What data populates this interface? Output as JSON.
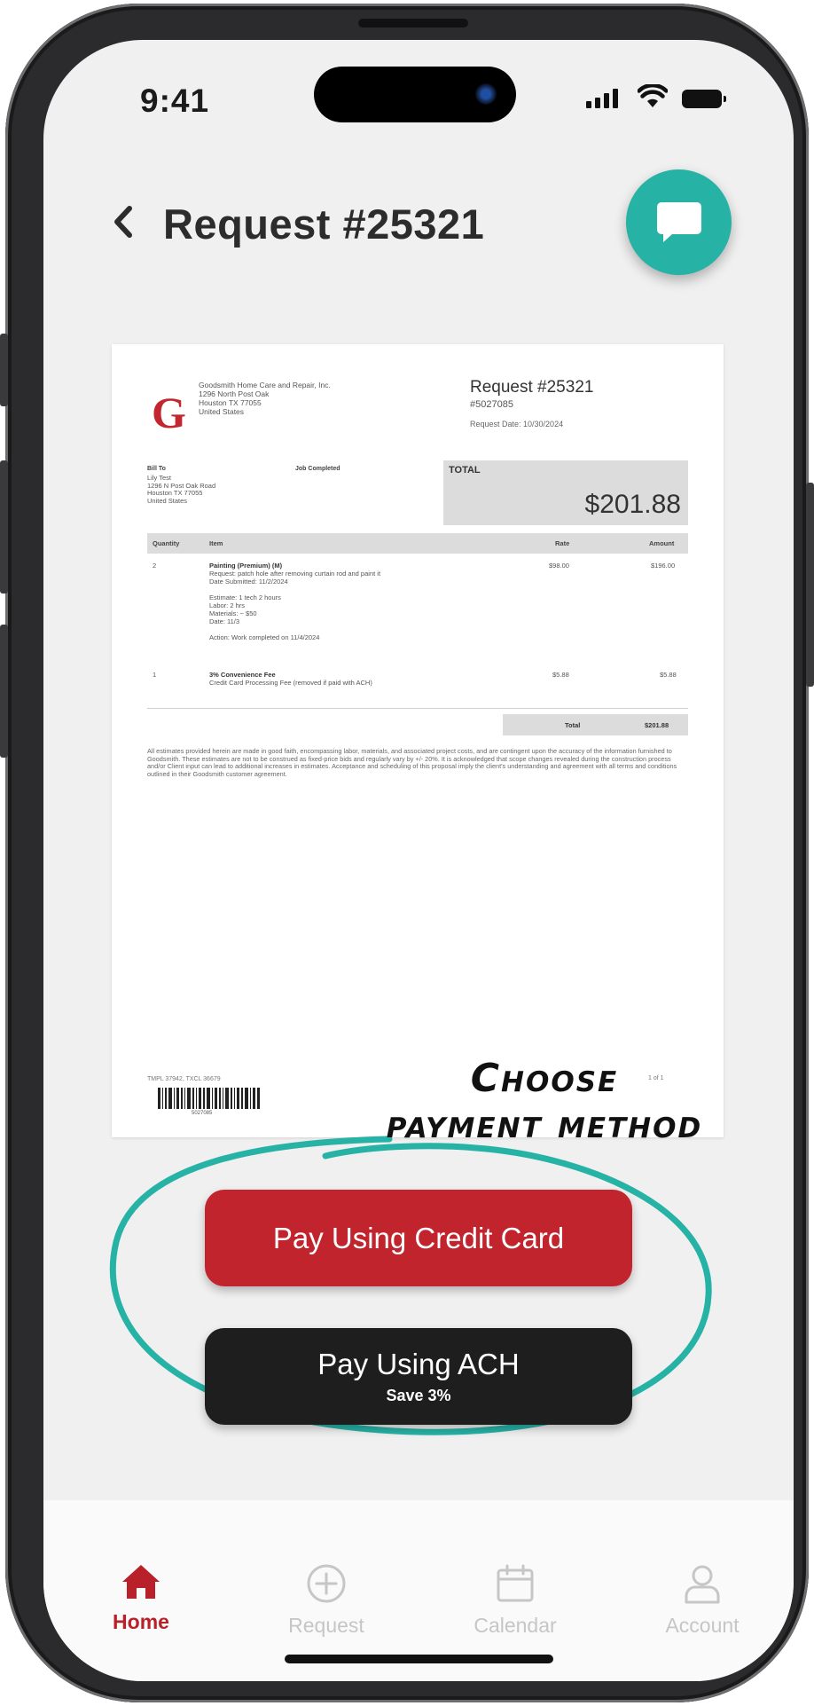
{
  "status_bar": {
    "time": "9:41"
  },
  "header": {
    "title": "Request #25321"
  },
  "document": {
    "company_lines": [
      "Goodsmith Home Care and Repair, Inc.",
      "1296 North Post Oak",
      "Houston TX 77055",
      "United States"
    ],
    "request_title": "Request #25321",
    "request_id": "#5027085",
    "request_date": "Request Date: 10/30/2024",
    "bill_to_header": "Bill To",
    "bill_to_lines": [
      "Lily Test",
      "1296 N Post Oak Road",
      "Houston TX 77055",
      "United States"
    ],
    "job_status": "Job Completed",
    "total_label": "TOTAL",
    "total_amount": "$201.88",
    "table_headers": {
      "quantity": "Quantity",
      "item": "Item",
      "rate": "Rate",
      "amount": "Amount"
    },
    "line_items": [
      {
        "qty": "2",
        "title": "Painting (Premium) (M)",
        "desc": "Request: patch hole after removing curtain rod and paint it",
        "date": "Date Submitted: 11/2/2024",
        "estimate": [
          "Estimate: 1 tech 2 hours",
          "Labor: 2 hrs",
          "Materials: ~ $50",
          "Date: 11/3"
        ],
        "action": "Action: Work completed on 11/4/2024",
        "rate": "$98.00",
        "amount": "$196.00"
      },
      {
        "qty": "1",
        "title": "3% Convenience Fee",
        "desc": "Credit Card Processing Fee (removed if paid with ACH)",
        "rate": "$5.88",
        "amount": "$5.88"
      }
    ],
    "total_row": {
      "label": "Total",
      "value": "$201.88"
    },
    "disclaimer": "All estimates provided herein are made in good faith, encompassing labor, materials, and associated project costs, and are contingent upon the accuracy of the information furnished to Goodsmith. These estimates are not to be construed as fixed-price bids and regularly vary by +/- 20%. It is acknowledged that scope changes revealed during the construction process and/or Client input can lead to additional increases in estimates. Acceptance and scheduling of this proposal imply the client's understanding and agreement with all terms and conditions outlined in their Goodsmith customer agreement.",
    "footer_id": "TMPL 37942, TXCL 36679",
    "barcode_number": "5027085",
    "page_number": "1 of 1"
  },
  "annotation": {
    "line1": "Choose",
    "line2": "payment method"
  },
  "payment": {
    "credit_label": "Pay Using Credit Card",
    "ach_label": "Pay Using ACH",
    "ach_sub": "Save 3%"
  },
  "tabbar": {
    "items": [
      {
        "label": "Home",
        "icon": "home-icon",
        "active": true
      },
      {
        "label": "Request",
        "icon": "plus-circle-icon",
        "active": false
      },
      {
        "label": "Calendar",
        "icon": "calendar-icon",
        "active": false
      },
      {
        "label": "Account",
        "icon": "user-icon",
        "active": false
      }
    ]
  },
  "colors": {
    "brand_red": "#c1242c",
    "teal": "#27b2a6",
    "ach_black": "#1e1e1e",
    "inactive_tab": "#c6c6c6"
  }
}
